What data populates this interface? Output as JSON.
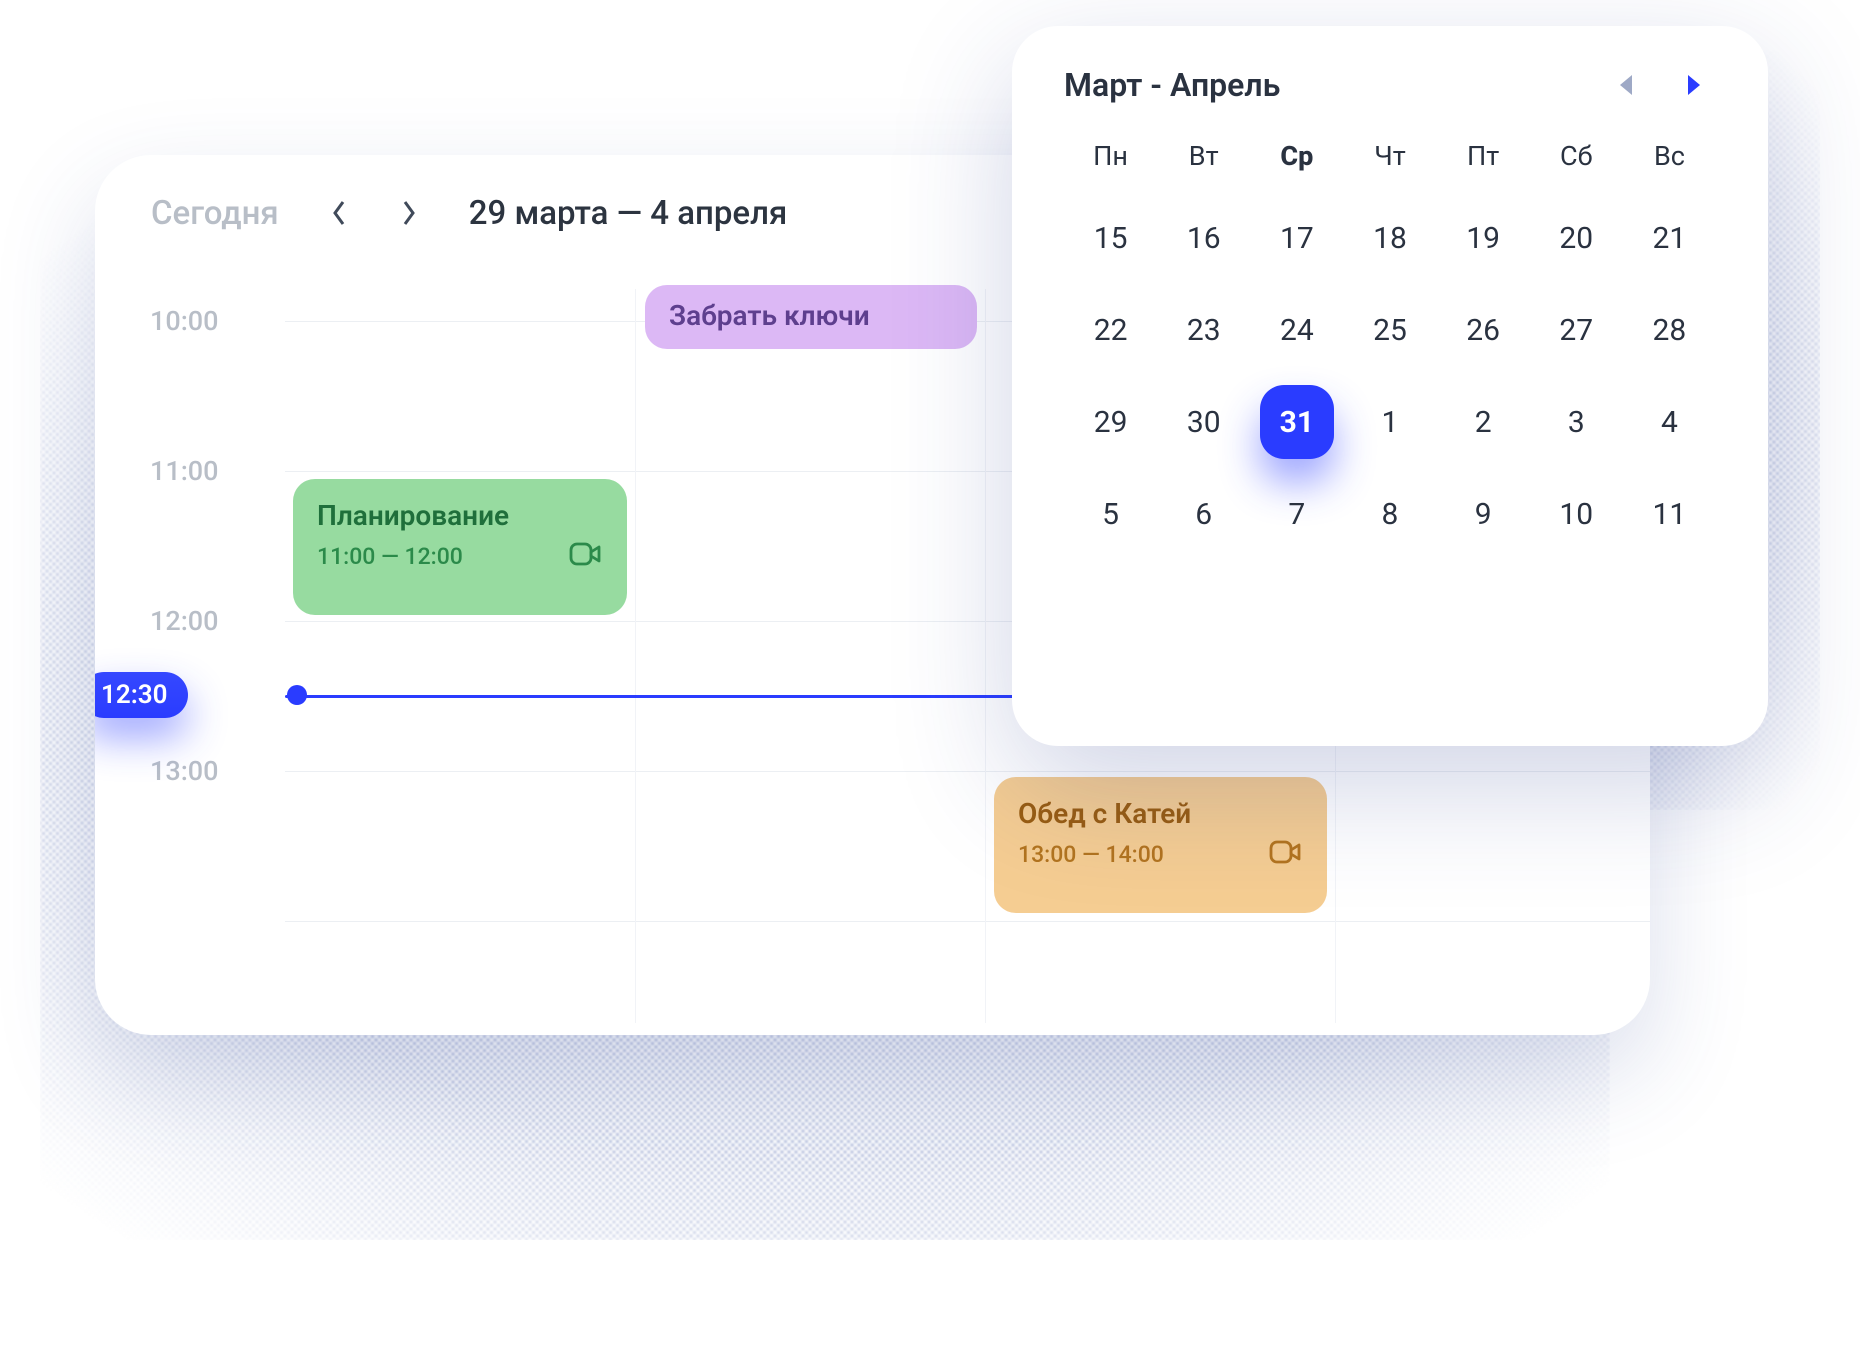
{
  "header": {
    "today_label": "Сегодня",
    "range_label": "29 марта — 4  апреля"
  },
  "time_labels": [
    "10:00",
    "11:00",
    "12:00",
    "13:00"
  ],
  "now": {
    "label": "12:30"
  },
  "events": {
    "purple": {
      "title": "Забрать ключи"
    },
    "green": {
      "title": "Планирование",
      "time": "11:00 — 12:00"
    },
    "orange": {
      "title": "Обед с Катей",
      "time": "13:00 — 14:00"
    }
  },
  "picker": {
    "title": "Март - Апрель",
    "dows": [
      "Пн",
      "Вт",
      "Ср",
      "Чт",
      "Пт",
      "Сб",
      "Вс"
    ],
    "active_dow_index": 2,
    "selected_day": "31",
    "rows": [
      [
        "15",
        "16",
        "17",
        "18",
        "19",
        "20",
        "21"
      ],
      [
        "22",
        "23",
        "24",
        "25",
        "26",
        "27",
        "28"
      ],
      [
        "29",
        "30",
        "31",
        "1",
        "2",
        "3",
        "4"
      ],
      [
        "5",
        "6",
        "7",
        "8",
        "9",
        "10",
        "11"
      ]
    ]
  },
  "colors": {
    "accent": "#2a3cff"
  }
}
